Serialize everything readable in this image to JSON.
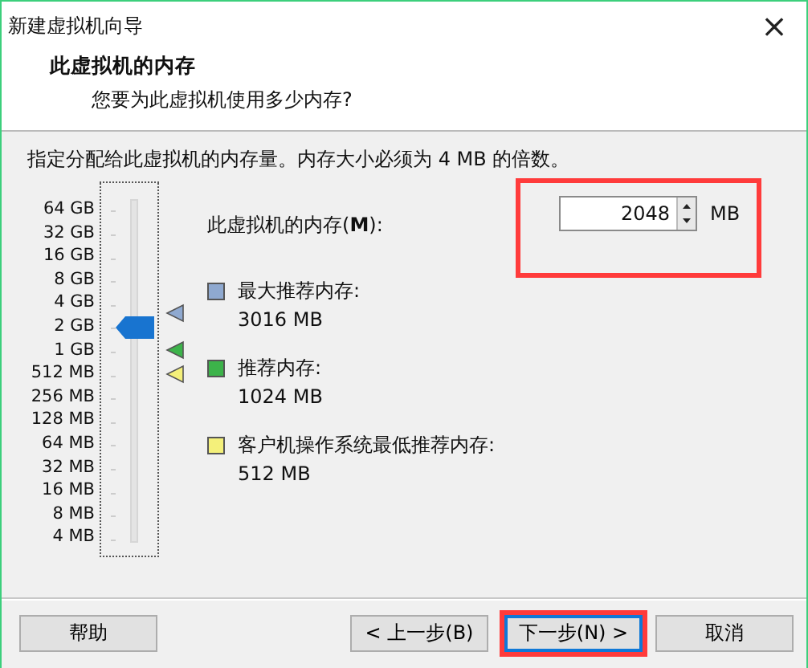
{
  "window": {
    "title": "新建虚拟机向导",
    "close": "×"
  },
  "header": {
    "title": "此虚拟机的内存",
    "subtitle": "您要为此虚拟机使用多少内存?"
  },
  "instruction": "指定分配给此虚拟机的内存量。内存大小必须为 4 MB 的倍数。",
  "slider": {
    "labels": [
      "64 GB",
      "32 GB",
      "16 GB",
      "8 GB",
      "4 GB",
      "2 GB",
      "1 GB",
      "512 MB",
      "256 MB",
      "128 MB",
      "64 MB",
      "32 MB",
      "16 MB",
      "8 MB",
      "4 MB"
    ],
    "level": 0.643
  },
  "memory_field": {
    "label": "此虚拟机的内存(**M**):",
    "value": "2048",
    "unit": "MB",
    "highlighted": true
  },
  "legend": [
    {
      "label": "最大推荐内存:",
      "value": "3016 MB",
      "color": "#8fa9d0"
    },
    {
      "label": "推荐内存:",
      "value": "1024 MB",
      "color": "#3cb34a"
    },
    {
      "label": "客户机操作系统最低推荐内存:",
      "value": "512 MB",
      "color": "#f4f07a"
    }
  ],
  "buttons": [
    {
      "label": "帮助",
      "kind": "help",
      "focused": false,
      "highlighted": false
    },
    {
      "label": "< 上一步(B)",
      "kind": "back",
      "focused": false,
      "highlighted": false
    },
    {
      "label": "下一步(N) >",
      "kind": "next",
      "focused": true,
      "highlighted": true
    },
    {
      "label": "取消",
      "kind": "cancel",
      "focused": false,
      "highlighted": false
    }
  ]
}
